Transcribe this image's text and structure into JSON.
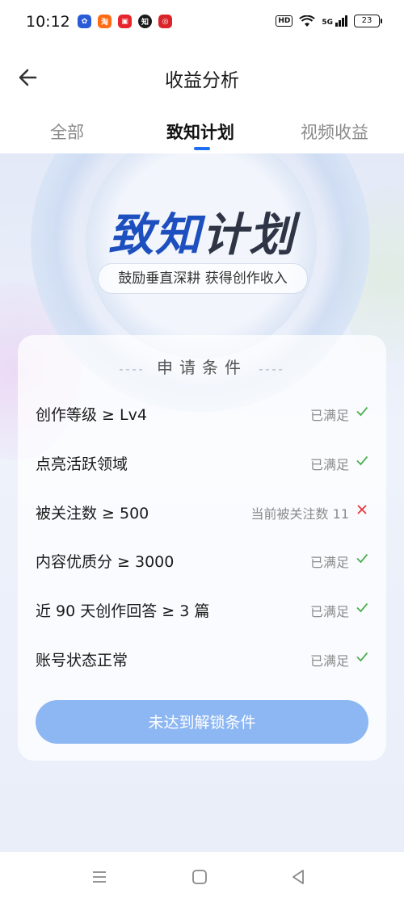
{
  "status_bar": {
    "time": "10:12",
    "app_icons": [
      {
        "name": "baidu-icon",
        "color": "#2a5bd7",
        "glyph": "✿"
      },
      {
        "name": "taobao-icon",
        "color": "#ff6a13",
        "glyph": "淘"
      },
      {
        "name": "app-red-icon",
        "color": "#e8242c",
        "glyph": "▣"
      },
      {
        "name": "zhihu-icon",
        "color": "#1a1a1a",
        "glyph": "知"
      },
      {
        "name": "bank-icon",
        "color": "#d9252a",
        "glyph": "◎"
      }
    ],
    "hd_label": "HD",
    "network_label": "5G",
    "battery": "23"
  },
  "header": {
    "title": "收益分析"
  },
  "tabs": [
    {
      "label": "全部",
      "active": false
    },
    {
      "label": "致知计划",
      "active": true
    },
    {
      "label": "视频收益",
      "active": false
    }
  ],
  "hero": {
    "title_part1": "致知",
    "title_part2": "计划",
    "subtitle": "鼓励垂直深耕 获得创作收入"
  },
  "conditions": {
    "header_dash": "----",
    "header": "申请条件",
    "items": [
      {
        "label": "创作等级 ≥ Lv4",
        "status": "已满足",
        "met": true
      },
      {
        "label": "点亮活跃领域",
        "status": "已满足",
        "met": true
      },
      {
        "label": "被关注数 ≥ 500",
        "status": "当前被关注数 11",
        "met": false
      },
      {
        "label": "内容优质分 ≥ 3000",
        "status": "已满足",
        "met": true
      },
      {
        "label": "近 90 天创作回答 ≥ 3 篇",
        "status": "已满足",
        "met": true
      },
      {
        "label": "账号状态正常",
        "status": "已满足",
        "met": true
      }
    ],
    "button_label": "未达到解锁条件"
  },
  "colors": {
    "accent": "#1f6ff0",
    "met": "#4caf50",
    "not_met": "#e5393b",
    "button": "#8db7f3"
  }
}
